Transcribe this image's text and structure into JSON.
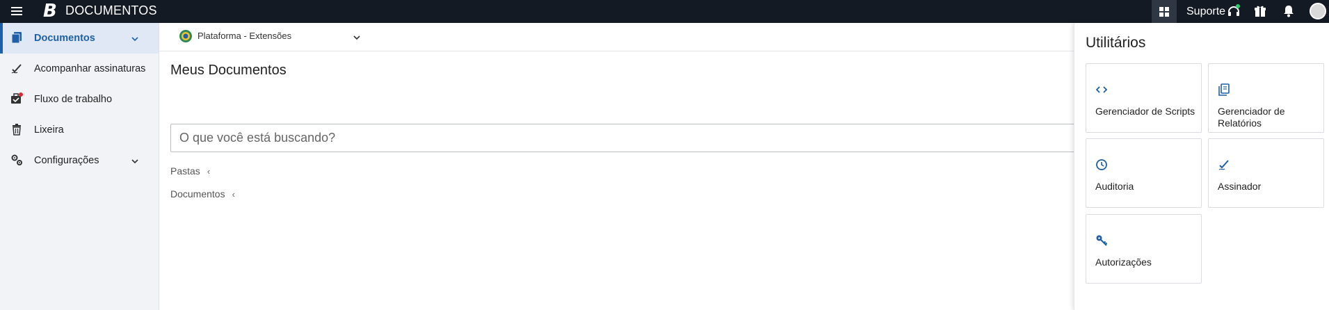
{
  "header": {
    "menu_icon": "hamburger-icon",
    "logo": "B",
    "app_title": "DOCUMENTOS",
    "apps_icon": "grid-icon",
    "support_label": "Suporte",
    "support_icon": "headset-icon",
    "gift_icon": "gift-icon",
    "bell_icon": "bell-icon",
    "avatar_icon": "avatar-icon"
  },
  "sidebar": {
    "items": [
      {
        "label": "Documentos",
        "icon": "document-icon",
        "active": true,
        "expandable": true
      },
      {
        "label": "Acompanhar assinaturas",
        "icon": "signature-icon",
        "active": false,
        "expandable": false
      },
      {
        "label": "Fluxo de trabalho",
        "icon": "briefcase-check-icon",
        "active": false,
        "expandable": false,
        "badge": "red-dot"
      },
      {
        "label": "Lixeira",
        "icon": "trash-icon",
        "active": false,
        "expandable": false
      },
      {
        "label": "Configurações",
        "icon": "gears-icon",
        "active": false,
        "expandable": true
      }
    ]
  },
  "main": {
    "platform_label": "Plataforma - Extensões",
    "platform_icon": "coat-of-arms-icon",
    "page_title": "Meus Documentos",
    "search_placeholder": "O que você está buscando?",
    "sections": [
      {
        "label": "Pastas",
        "arrow": "‹"
      },
      {
        "label": "Documentos",
        "arrow": "‹"
      }
    ]
  },
  "utilities": {
    "title": "Utilitários",
    "tiles": [
      {
        "label": "Gerenciador de Scripts",
        "icon": "code-icon"
      },
      {
        "label": "Gerenciador de Relatórios",
        "icon": "report-icon"
      },
      {
        "label": "Auditoria",
        "icon": "clock-icon"
      },
      {
        "label": "Assinador",
        "icon": "signature-icon"
      },
      {
        "label": "Autorizações",
        "icon": "key-icon"
      }
    ]
  },
  "colors": {
    "topbar_bg": "#141a23",
    "accent": "#1f5fa8",
    "sidebar_bg": "#f1f3f6",
    "sidebar_active_bg": "#dfe8f4",
    "badge_red": "#e0243a",
    "support_online": "#2ecc71"
  }
}
